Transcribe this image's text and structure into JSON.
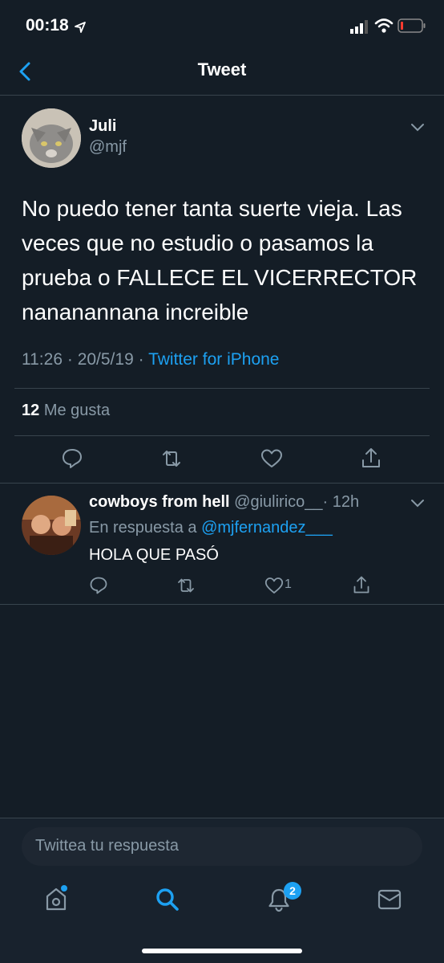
{
  "status_bar": {
    "time": "00:18"
  },
  "header": {
    "title": "Tweet"
  },
  "tweet": {
    "display_name": "Juli",
    "handle": "@mjf",
    "text": "No puedo tener tanta suerte vieja. Las veces que no estudio o pasamos la prueba o FALLECE EL VICERRECTOR nananannana increible",
    "time": "11:26",
    "separator": "·",
    "date": "20/5/19",
    "source": "Twitter for iPhone",
    "likes_count": "12",
    "likes_label": "Me gusta"
  },
  "reply": {
    "display_name": "cowboys from hell",
    "handle": "@giulirico__",
    "separator": "·",
    "time": "12h",
    "in_reply_prefix": "En respuesta a",
    "in_reply_handle": "@mjfernandez___",
    "text": "HOLA QUE PASÓ",
    "like_count": "1"
  },
  "compose": {
    "placeholder": "Twittea tu respuesta"
  },
  "tab_bar": {
    "notifications_badge": "2"
  },
  "colors": {
    "background": "#141d26",
    "accent": "#1da1f2",
    "muted": "#8899a6",
    "divider": "#38444d"
  }
}
